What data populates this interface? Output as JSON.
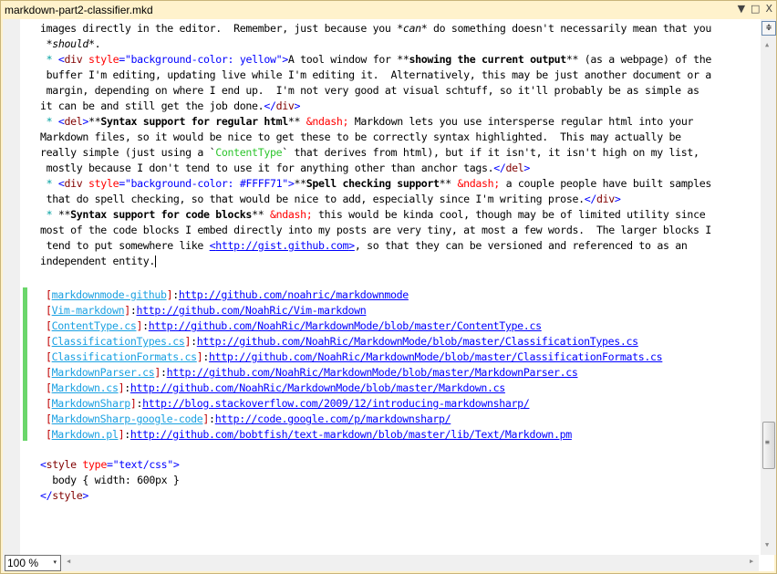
{
  "window": {
    "title": "markdown-part2-classifier.mkd",
    "dropdown_icon": "▼",
    "maximize_icon": "□",
    "close_icon": "X"
  },
  "editor": {
    "lines": [
      {
        "segments": [
          {
            "t": "images directly in the editor.  Remember, just because you "
          },
          {
            "t": "*"
          },
          {
            "t": "can",
            "c": "i"
          },
          {
            "t": "*"
          },
          {
            "t": " do something doesn't necessarily mean that you"
          }
        ],
        "wrap": true,
        "indent": 1
      },
      {
        "segments": [
          {
            "t": " *"
          },
          {
            "t": "should",
            "c": "i"
          },
          {
            "t": "*."
          }
        ],
        "wrap": false,
        "indent": 1
      },
      {
        "segments": [
          {
            "t": " * ",
            "c": "star"
          },
          {
            "t": "<",
            "c": "kw"
          },
          {
            "t": "div",
            "c": "tag"
          },
          {
            "t": " style",
            "c": "attr"
          },
          {
            "t": "=",
            "c": "kw"
          },
          {
            "t": "\"background-color: yellow\"",
            "c": "val"
          },
          {
            "t": ">",
            "c": "kw"
          },
          {
            "t": "A tool window for **"
          },
          {
            "t": "showing the current output",
            "c": "b"
          },
          {
            "t": "** (as a webpage) of the"
          }
        ],
        "wrap": true,
        "indent": 1
      },
      {
        "segments": [
          {
            "t": " buffer I'm editing, updating live while I'm editing it.  Alternatively, this may be just another document or a"
          }
        ],
        "wrap": true,
        "indent": 1
      },
      {
        "segments": [
          {
            "t": " margin, depending on where I end up.  I'm not very good at visual schtuff, so it'll probably be as simple as  "
          }
        ],
        "wrap": true,
        "indent": 1
      },
      {
        "segments": [
          {
            "t": "it can be and still get the job done."
          },
          {
            "t": "</",
            "c": "kw"
          },
          {
            "t": "div",
            "c": "tag"
          },
          {
            "t": ">",
            "c": "kw"
          }
        ],
        "wrap": false,
        "indent": 0
      },
      {
        "segments": [
          {
            "t": " * ",
            "c": "star"
          },
          {
            "t": "<",
            "c": "kw"
          },
          {
            "t": "del",
            "c": "tag"
          },
          {
            "t": ">",
            "c": "kw"
          },
          {
            "t": "**"
          },
          {
            "t": "Syntax support for regular html",
            "c": "b"
          },
          {
            "t": "** "
          },
          {
            "t": "&ndash;",
            "c": "ent"
          },
          {
            "t": " Markdown lets you use intersperse regular html into your "
          }
        ],
        "wrap": true,
        "indent": 1
      },
      {
        "segments": [
          {
            "t": "Markdown files, so it would be nice to get these to be correctly syntax highlighted.  This may actually be"
          }
        ],
        "wrap": true,
        "indent": 0
      },
      {
        "segments": [
          {
            "t": "really simple (just using a `"
          },
          {
            "t": "ContentType",
            "c": "code"
          },
          {
            "t": "` that derives from html), but if it isn't, it isn't high on my list,"
          }
        ],
        "wrap": true,
        "indent": 0
      },
      {
        "segments": [
          {
            "t": " mostly because I don't tend to use it for anything other than anchor tags."
          },
          {
            "t": "</",
            "c": "kw"
          },
          {
            "t": "del",
            "c": "tag"
          },
          {
            "t": ">",
            "c": "kw"
          }
        ],
        "wrap": false,
        "indent": 0
      },
      {
        "segments": [
          {
            "t": " * ",
            "c": "star"
          },
          {
            "t": "<",
            "c": "kw"
          },
          {
            "t": "div",
            "c": "tag"
          },
          {
            "t": " style",
            "c": "attr"
          },
          {
            "t": "=",
            "c": "kw"
          },
          {
            "t": "\"background-color: #FFFF71\"",
            "c": "val"
          },
          {
            "t": ">",
            "c": "kw"
          },
          {
            "t": "**"
          },
          {
            "t": "Spell checking support",
            "c": "b"
          },
          {
            "t": "** "
          },
          {
            "t": "&ndash;",
            "c": "ent"
          },
          {
            "t": " a couple people have built samples"
          }
        ],
        "wrap": true,
        "indent": 1
      },
      {
        "segments": [
          {
            "t": " that do spell checking, so that would be nice to add, especially since I'm writing prose."
          },
          {
            "t": "</",
            "c": "kw"
          },
          {
            "t": "div",
            "c": "tag"
          },
          {
            "t": ">",
            "c": "kw"
          }
        ],
        "wrap": false,
        "indent": 0
      },
      {
        "segments": [
          {
            "t": " * ",
            "c": "star"
          },
          {
            "t": "**"
          },
          {
            "t": "Syntax support for code blocks",
            "c": "b"
          },
          {
            "t": "** "
          },
          {
            "t": "&ndash;",
            "c": "ent"
          },
          {
            "t": " this would be kinda cool, though may be of limited utility since "
          }
        ],
        "wrap": true,
        "indent": 1
      },
      {
        "segments": [
          {
            "t": "most of the code blocks I embed directly into my posts are very tiny, at most a few words.  The larger blocks I"
          }
        ],
        "wrap": true,
        "indent": 0
      },
      {
        "segments": [
          {
            "t": " tend to put somewhere like "
          },
          {
            "t": "<",
            "c": "link"
          },
          {
            "t": "http://gist.github.com",
            "c": "link"
          },
          {
            "t": ">",
            "c": "link"
          },
          {
            "t": ", so that they can be versioned and referenced to as an     "
          }
        ],
        "wrap": true,
        "indent": 0
      },
      {
        "segments": [
          {
            "t": "independent entity."
          }
        ],
        "wrap": false,
        "indent": 0,
        "caret": true
      }
    ],
    "link_refs": [
      {
        "name": "markdownmode-github",
        "url": "http://github.com/noahric/markdownmode"
      },
      {
        "name": "Vim-markdown",
        "url": "http://github.com/NoahRic/Vim-markdown"
      },
      {
        "name": "ContentType.cs",
        "url": "http://github.com/NoahRic/MarkdownMode/blob/master/ContentType.cs"
      },
      {
        "name": "ClassificationTypes.cs",
        "url": "http://github.com/NoahRic/MarkdownMode/blob/master/ClassificationTypes.cs"
      },
      {
        "name": "ClassificationFormats.cs",
        "url": "http://github.com/NoahRic/MarkdownMode/blob/master/ClassificationFormats.cs"
      },
      {
        "name": "MarkdownParser.cs",
        "url": "http://github.com/NoahRic/MarkdownMode/blob/master/MarkdownParser.cs"
      },
      {
        "name": "Markdown.cs",
        "url": "http://github.com/NoahRic/MarkdownMode/blob/master/Markdown.cs"
      },
      {
        "name": "MarkdownSharp",
        "url": "http://blog.stackoverflow.com/2009/12/introducing-markdownsharp/"
      },
      {
        "name": "MarkdownSharp-google-code",
        "url": "http://code.google.com/p/markdownsharp/"
      },
      {
        "name": "Markdown.pl",
        "url": "http://github.com/bobtfish/text-markdown/blob/master/lib/Text/Markdown.pm"
      }
    ],
    "style_block": {
      "open_lt": "<",
      "open_tag": "style",
      "attr": " type",
      "eq": "=",
      "attr_val": "\"text/css\"",
      "gt": ">",
      "body_rule": "  body { width: 600px }",
      "close": "</style>"
    },
    "colors": {
      "change_bar": "#6bd66b",
      "keyword": "#0000ff",
      "tag": "#800000",
      "attribute": "#ff0000",
      "code_span": "#2ec52e",
      "link_name": "#1ba1e2",
      "link_url": "#0000ff",
      "frame": "#fff2cc"
    }
  },
  "statusbar": {
    "zoom_level": "100 %"
  },
  "scrollbar": {
    "vertical_position_fraction": 0.78
  },
  "icons": {
    "wrap": "⮐",
    "split": "≑",
    "up": "▲",
    "down": "▼",
    "left": "◀",
    "right": "▶",
    "dropdown": "▾"
  }
}
